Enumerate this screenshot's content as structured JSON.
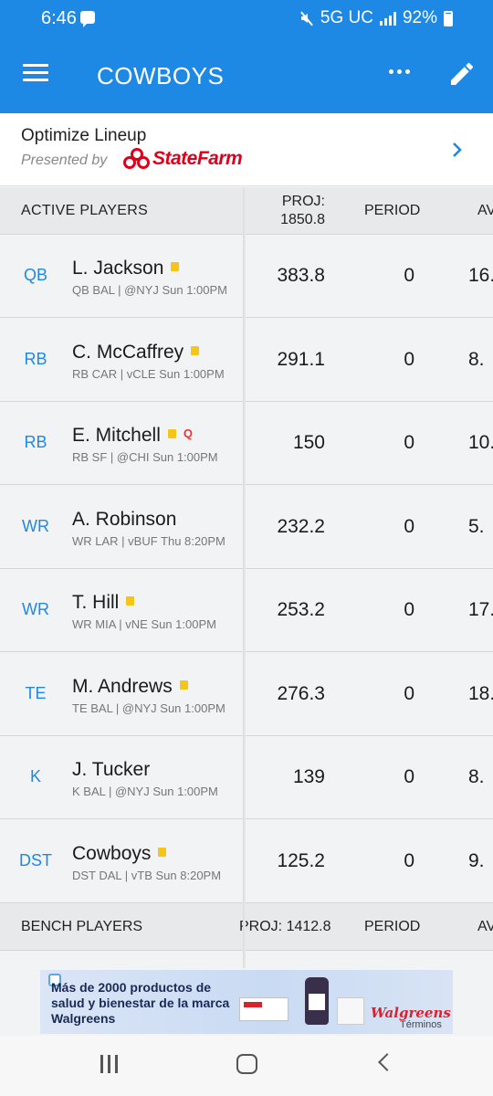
{
  "status_bar": {
    "time": "6:46",
    "network": "5G UC",
    "battery": "92%"
  },
  "app_bar": {
    "title": "COWBOYS"
  },
  "optimize": {
    "title": "Optimize Lineup",
    "presented_by": "Presented by",
    "sponsor": "StateFarm"
  },
  "active_header": {
    "label": "ACTIVE PLAYERS",
    "proj_label": "PROJ:",
    "proj_total": "1850.8",
    "period_label": "PERIOD",
    "avg_label": "AV"
  },
  "players": [
    {
      "pos": "QB",
      "name": "L. Jackson",
      "note": true,
      "q": "",
      "detail": "QB BAL | @NYJ Sun 1:00PM",
      "proj": "383.8",
      "period": "0",
      "avg": "16."
    },
    {
      "pos": "RB",
      "name": "C. McCaffrey",
      "note": true,
      "q": "",
      "detail": "RB CAR | vCLE Sun 1:00PM",
      "proj": "291.1",
      "period": "0",
      "avg": "8."
    },
    {
      "pos": "RB",
      "name": "E. Mitchell",
      "note": true,
      "q": "Q",
      "detail": "RB SF | @CHI Sun 1:00PM",
      "proj": "150",
      "period": "0",
      "avg": "10."
    },
    {
      "pos": "WR",
      "name": "A. Robinson",
      "note": false,
      "q": "",
      "detail": "WR LAR | vBUF Thu 8:20PM",
      "proj": "232.2",
      "period": "0",
      "avg": "5."
    },
    {
      "pos": "WR",
      "name": "T. Hill",
      "note": true,
      "q": "",
      "detail": "WR MIA | vNE Sun 1:00PM",
      "proj": "253.2",
      "period": "0",
      "avg": "17."
    },
    {
      "pos": "TE",
      "name": "M. Andrews",
      "note": true,
      "q": "",
      "detail": "TE BAL | @NYJ Sun 1:00PM",
      "proj": "276.3",
      "period": "0",
      "avg": "18."
    },
    {
      "pos": "K",
      "name": "J. Tucker",
      "note": false,
      "q": "",
      "detail": "K BAL | @NYJ Sun 1:00PM",
      "proj": "139",
      "period": "0",
      "avg": "8."
    },
    {
      "pos": "DST",
      "name": "Cowboys",
      "note": true,
      "q": "",
      "detail": "DST DAL | vTB Sun 8:20PM",
      "proj": "125.2",
      "period": "0",
      "avg": "9."
    }
  ],
  "bench_header": {
    "label": "BENCH PLAYERS",
    "proj": "PROJ: 1412.8",
    "period_label": "PERIOD",
    "avg_label": "AV"
  },
  "ad": {
    "text": "Más de 2000 productos de salud y bienestar de la marca Walgreens",
    "brand": "Walgreens",
    "terms": "Términos"
  },
  "colors": {
    "primary": "#1e88e5",
    "sponsor_red": "#e0001b",
    "note_yellow": "#f5c518",
    "q_red": "#e53935"
  }
}
